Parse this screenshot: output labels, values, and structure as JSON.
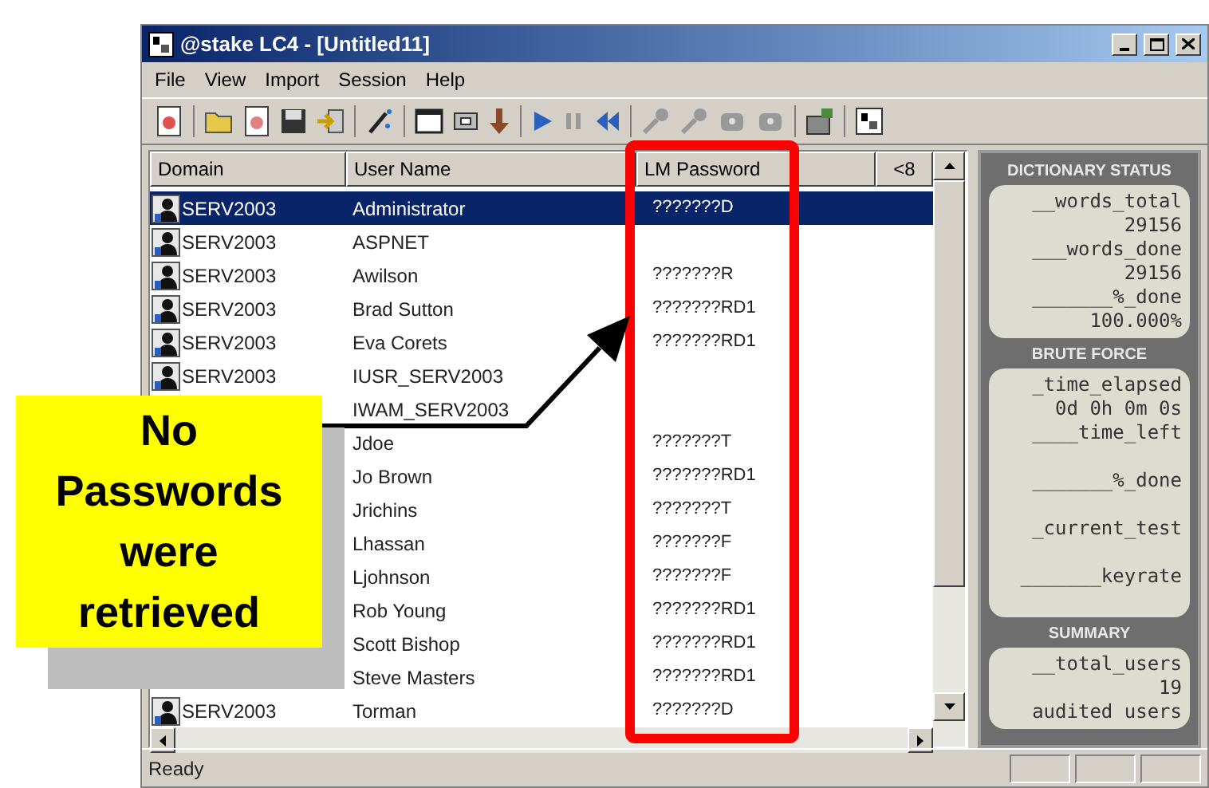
{
  "window": {
    "title": "@stake LC4 - [Untitled11]"
  },
  "menu": [
    "File",
    "View",
    "Import",
    "Session",
    "Help"
  ],
  "table": {
    "columns": [
      "Domain",
      "User Name",
      "LM Password",
      "<8"
    ],
    "rows": [
      {
        "domain": "SERV2003",
        "user": "Administrator",
        "lm_password": "???????D",
        "selected": true
      },
      {
        "domain": "SERV2003",
        "user": "ASPNET",
        "selected": false
      },
      {
        "domain": "SERV2003",
        "user": "Awilson",
        "lm_password": "???????R",
        "selected": false
      },
      {
        "domain": "SERV2003",
        "user": "Brad Sutton",
        "lm_password": "???????RD1",
        "selected": false
      },
      {
        "domain": "SERV2003",
        "user": "Eva Corets",
        "lm_password": "???????RD1",
        "selected": false
      },
      {
        "domain": "SERV2003",
        "user": "IUSR_SERV2003",
        "selected": false
      },
      {
        "user": "IWAM_SERV2003",
        "selected": false
      },
      {
        "user": "Jdoe",
        "lm_password": "???????T",
        "selected": false
      },
      {
        "user": "Jo Brown",
        "lm_password": "???????RD1",
        "selected": false
      },
      {
        "user": "Jrichins",
        "lm_password": "???????T",
        "selected": false
      },
      {
        "user": "Lhassan",
        "lm_password": "???????F",
        "selected": false
      },
      {
        "user": "Ljohnson",
        "lm_password": "???????F",
        "selected": false
      },
      {
        "user": "Rob Young",
        "lm_password": "???????RD1",
        "selected": false
      },
      {
        "user": "Scott Bishop",
        "lm_password": "???????RD1",
        "selected": false
      },
      {
        "user": "Steve Masters",
        "lm_password": "???????RD1",
        "selected": false
      },
      {
        "domain": "SERV2003",
        "user": "Torman",
        "lm_password": "???????D",
        "selected": false
      }
    ]
  },
  "panel": {
    "sections": [
      {
        "title": "DICTIONARY STATUS",
        "fields": [
          {
            "label": "__words_total",
            "value": "29156"
          },
          {
            "label": "___words_done",
            "value": "29156"
          },
          {
            "label": "_______%_done",
            "value": "100.000%"
          }
        ]
      },
      {
        "title": "BRUTE FORCE",
        "fields": [
          {
            "label": "_time_elapsed",
            "value": "0d 0h 0m 0s"
          },
          {
            "label": "____time_left"
          },
          {
            "label": "_______%_done"
          },
          {
            "label": "_current_test"
          },
          {
            "label": "_______keyrate"
          }
        ]
      },
      {
        "title": "SUMMARY",
        "fields": [
          {
            "label": "__total_users",
            "value": "19"
          },
          {
            "label": "audited users"
          }
        ]
      }
    ]
  },
  "callout": {
    "text": "No Passwords were retrieved"
  },
  "status_bar": {
    "text": "Ready"
  }
}
